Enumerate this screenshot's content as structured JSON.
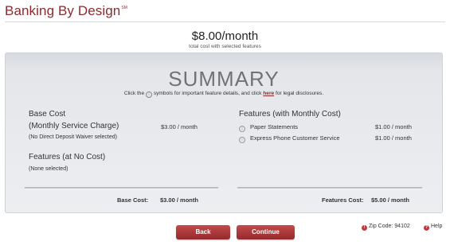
{
  "brand": {
    "title": "Banking By Design",
    "mark": "SM"
  },
  "summary_header": {
    "amount": "$8.00/month",
    "subtitle": "total cost with selected features"
  },
  "panel": {
    "title": "SUMMARY",
    "instructions_pre": "Click the",
    "instructions_mid": "symbols for important feature details, and click",
    "instructions_link": "here",
    "instructions_post": "for legal disclosures."
  },
  "base_cost": {
    "heading1": "Base Cost",
    "heading2": "(Monthly Service Charge)",
    "amount": "$3.00",
    "per": "/ month",
    "note": "(No Direct Deposit Waiver selected)"
  },
  "no_cost_features": {
    "heading": "Features (at No Cost)",
    "note": "(None selected)"
  },
  "monthly_features": {
    "heading": "Features (with Monthly Cost)",
    "items": [
      {
        "name": "Paper Statements",
        "amount": "$1.00",
        "per": "/ month"
      },
      {
        "name": "Express Phone Customer Service",
        "amount": "$1.00",
        "per": "/ month"
      }
    ]
  },
  "totals": {
    "base_label": "Base Cost:",
    "base_value": "$3.00 / month",
    "features_label": "Features Cost:",
    "features_value": "$5.00 / month"
  },
  "buttons": {
    "back": "Back",
    "continue": "Continue"
  },
  "footer": {
    "zip": "Zip Code: 94102",
    "help": "Help"
  },
  "icons": {
    "info": "info-icon",
    "alert": "exclamation-icon",
    "help": "question-icon"
  },
  "colors": {
    "brand": "#8a2b2f",
    "button": "#b23b3e"
  }
}
